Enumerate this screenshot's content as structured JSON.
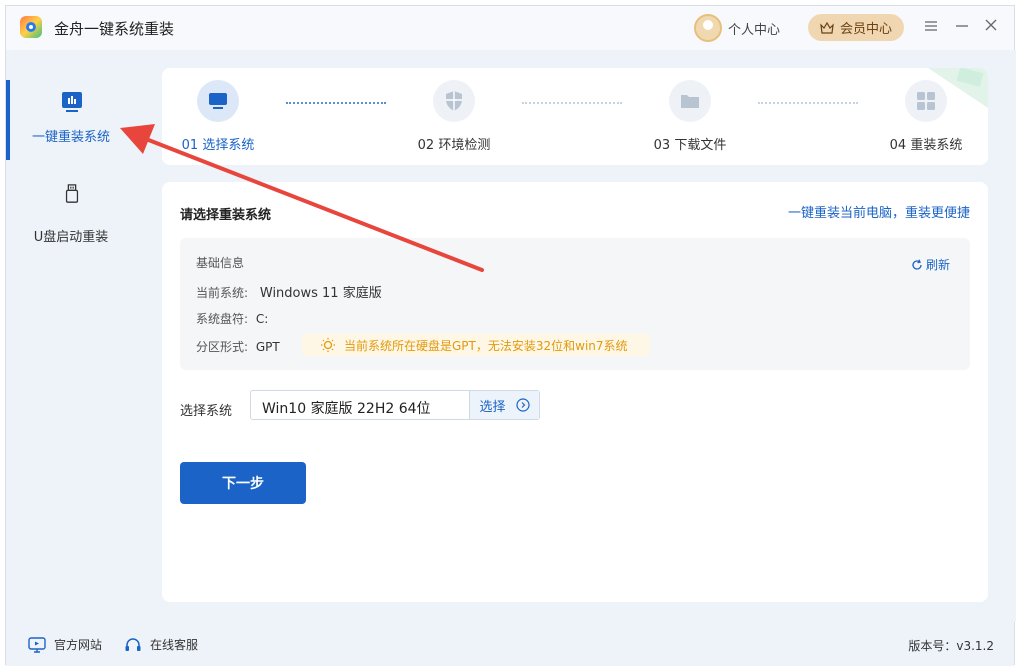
{
  "app": {
    "title": "金舟一键系统重装"
  },
  "header": {
    "user_center": "个人中心",
    "vip_center": "会员中心"
  },
  "sidebar": {
    "items": [
      {
        "label": "一键重装系统",
        "icon": "chart-icon",
        "active": true
      },
      {
        "label": "U盘启动重装",
        "icon": "usb-icon",
        "active": false
      }
    ]
  },
  "steps": [
    {
      "label": "01 选择系统",
      "icon": "monitor-icon",
      "active": true
    },
    {
      "label": "02 环境检测",
      "icon": "shield-icon",
      "active": false
    },
    {
      "label": "03 下载文件",
      "icon": "folder-icon",
      "active": false
    },
    {
      "label": "04 重装系统",
      "icon": "windows-icon",
      "active": false
    }
  ],
  "main": {
    "title": "请选择重装系统",
    "quick_link": "一键重装当前电脑，重装更便捷",
    "info": {
      "heading": "基础信息",
      "refresh": "刷新",
      "current_system_label": "当前系统:",
      "current_system_value": "Windows 11 家庭版",
      "drive_label": "系统盘符:",
      "drive_value": "C:",
      "partition_label": "分区形式:",
      "partition_value": "GPT",
      "warning": "当前系统所在硬盘是GPT，无法安装32位和win7系统"
    },
    "select_label": "选择系统",
    "select_value": "Win10 家庭版 22H2 64位",
    "select_button": "选择",
    "next_button": "下一步"
  },
  "footer": {
    "website": "官方网站",
    "support": "在线客服",
    "version": "版本号：v3.1.2"
  },
  "colors": {
    "accent": "#1b63c6",
    "warning": "#e19a0f",
    "arrow": "#e8463c"
  }
}
